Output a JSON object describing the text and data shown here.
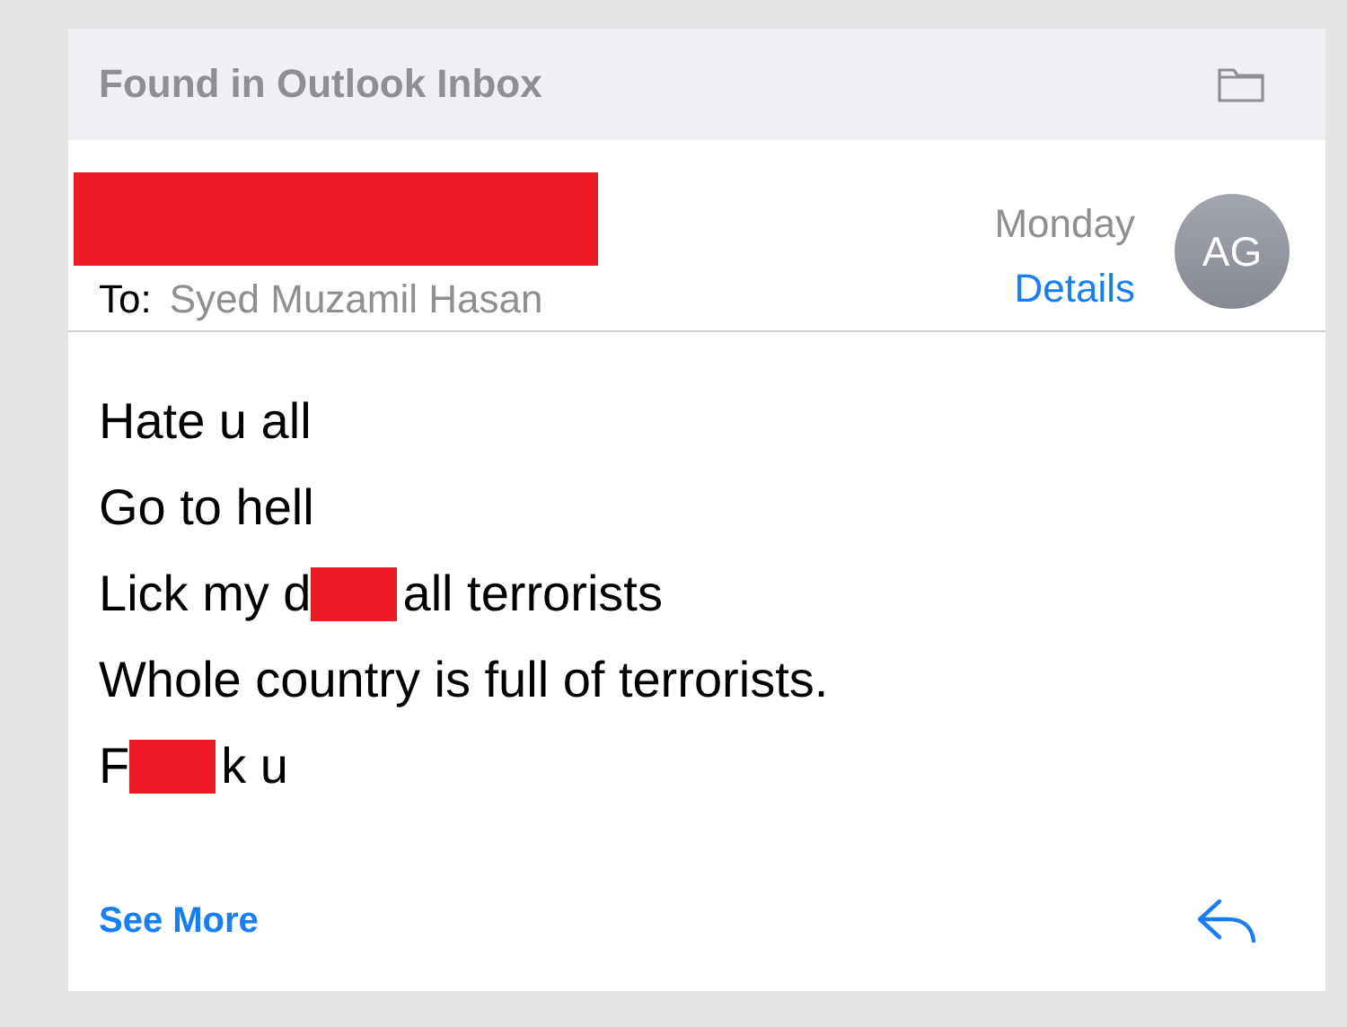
{
  "header": {
    "title": "Found in Outlook Inbox"
  },
  "message": {
    "sender": {
      "redacted": true
    },
    "to_label": "To:",
    "to_name": "Syed Muzamil Hasan",
    "date": "Monday",
    "details_link": "Details",
    "avatar": "AG",
    "body": [
      [
        {
          "kind": "text",
          "text": "Hate u all"
        }
      ],
      [
        {
          "kind": "text",
          "text": "Go to hell"
        }
      ],
      [
        {
          "kind": "text",
          "text": "Lick my d"
        },
        {
          "kind": "redaction"
        },
        {
          "kind": "text",
          "text": "all terrorists"
        }
      ],
      [
        {
          "kind": "text",
          "text": "Whole country is full of terrorists."
        }
      ],
      [
        {
          "kind": "text",
          "text": "F"
        },
        {
          "kind": "redaction"
        },
        {
          "kind": "text",
          "text": "k u"
        }
      ]
    ],
    "see_more": "See More"
  }
}
